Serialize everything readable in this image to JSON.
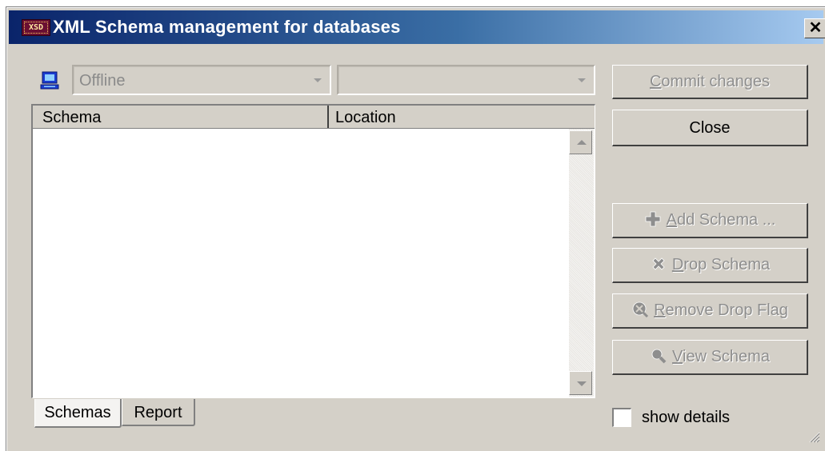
{
  "window": {
    "title": "XML Schema management for databases",
    "icon_label": "XSD",
    "close_glyph": "✕"
  },
  "connection": {
    "selected": "Offline",
    "secondary_selected": ""
  },
  "list": {
    "columns": [
      "Schema",
      "Location"
    ],
    "rows": []
  },
  "tabs": [
    "Schemas",
    "Report"
  ],
  "buttons": {
    "commit_prefix": "",
    "commit_mnemonic": "C",
    "commit_rest": "ommit changes",
    "close": "Close",
    "add_mnemonic": "A",
    "add_rest": "dd Schema ...",
    "drop_mnemonic": "D",
    "drop_rest": "rop Schema",
    "remove_mnemonic": "R",
    "remove_rest": "emove Drop Flag",
    "view_mnemonic": "V",
    "view_rest": "iew Schema"
  },
  "options": {
    "show_details_label": "show details",
    "show_details_checked": false
  },
  "colors": {
    "title_start": "#0a246a",
    "title_end": "#a6caf0",
    "face": "#d4d0c8",
    "disabled_text": "#8e8e8e"
  }
}
